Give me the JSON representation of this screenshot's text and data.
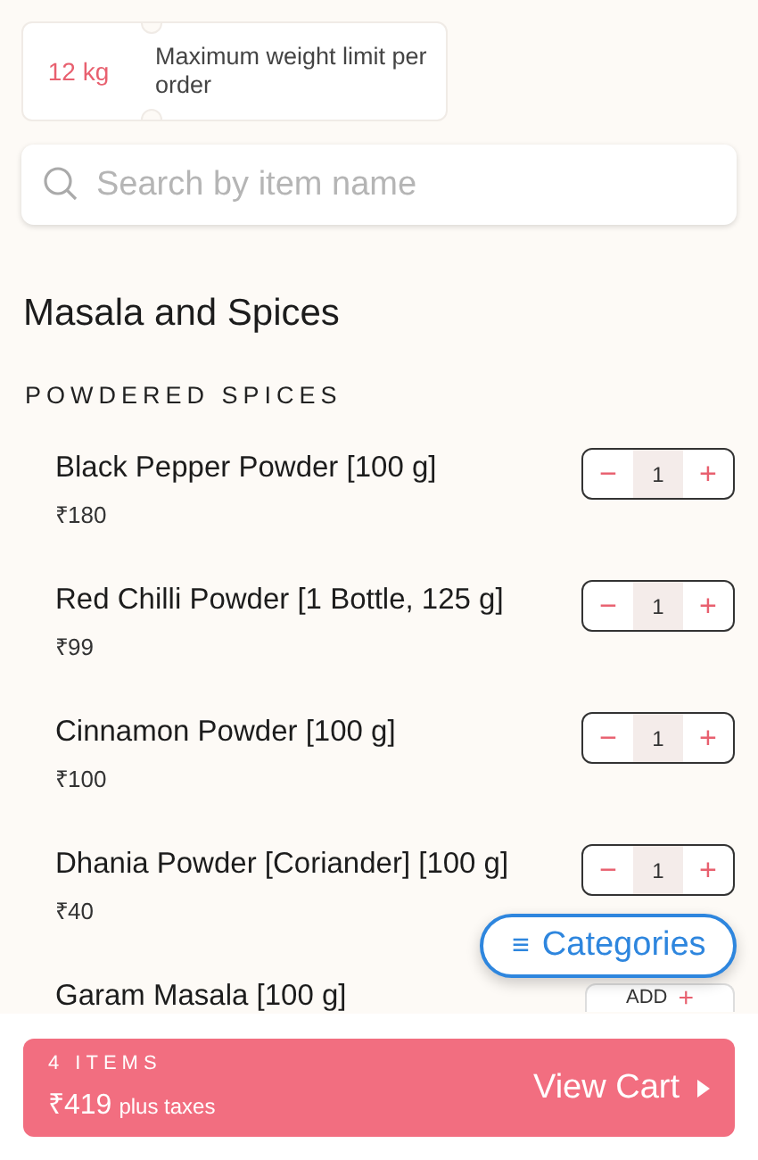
{
  "limit_card": {
    "value": "12 kg",
    "text": "Maximum weight limit per order"
  },
  "search": {
    "placeholder": "Search by item name"
  },
  "category": {
    "title": "Masala and Spices",
    "section": "POWDERED SPICES"
  },
  "items": [
    {
      "name": "Black Pepper Powder [100 g]",
      "price": "₹180",
      "kind": "stepper",
      "minus": "−",
      "quantity": "1",
      "plus": "+"
    },
    {
      "name": "Red Chilli Powder [1 Bottle, 125 g]",
      "price": "₹99",
      "kind": "stepper",
      "minus": "−",
      "quantity": "1",
      "plus": "+"
    },
    {
      "name": "Cinnamon Powder [100 g]",
      "price": "₹100",
      "kind": "stepper",
      "minus": "−",
      "quantity": "1",
      "plus": "+"
    },
    {
      "name": "Dhania Powder [Coriander] [100 g]",
      "price": "₹40",
      "kind": "stepper",
      "minus": "−",
      "quantity": "1",
      "plus": "+"
    },
    {
      "name": "Garam Masala [100 g]",
      "kind": "add",
      "label": "ADD",
      "plus": "+"
    }
  ],
  "categories_button": {
    "icon": "≡",
    "label": "Categories"
  },
  "cart": {
    "count": "4 ITEMS",
    "total": "₹419",
    "note": "plus taxes",
    "action": "View Cart"
  }
}
